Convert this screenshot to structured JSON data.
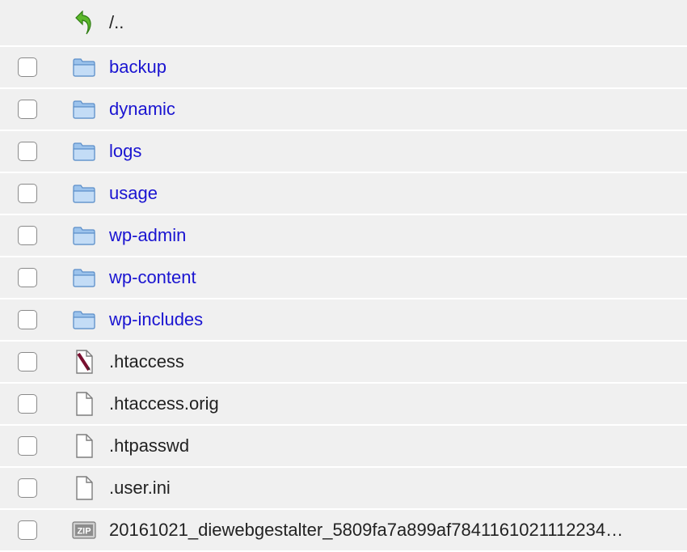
{
  "parent": {
    "label": "/..",
    "icon": "up-arrow-icon"
  },
  "entries": [
    {
      "name": "backup",
      "type": "folder",
      "icon": "folder-icon"
    },
    {
      "name": "dynamic",
      "type": "folder",
      "icon": "folder-icon"
    },
    {
      "name": "logs",
      "type": "folder",
      "icon": "folder-icon"
    },
    {
      "name": "usage",
      "type": "folder",
      "icon": "folder-icon"
    },
    {
      "name": "wp-admin",
      "type": "folder",
      "icon": "folder-icon"
    },
    {
      "name": "wp-content",
      "type": "folder",
      "icon": "folder-icon"
    },
    {
      "name": "wp-includes",
      "type": "folder",
      "icon": "folder-icon"
    },
    {
      "name": ".htaccess",
      "type": "file",
      "icon": "htaccess-file-icon"
    },
    {
      "name": ".htaccess.orig",
      "type": "file",
      "icon": "file-icon"
    },
    {
      "name": ".htpasswd",
      "type": "file",
      "icon": "file-icon"
    },
    {
      "name": ".user.ini",
      "type": "file",
      "icon": "file-icon"
    },
    {
      "name": "20161021_diewebgestalter_5809fa7a899af7841161021112234…",
      "type": "file",
      "icon": "zip-file-icon"
    }
  ],
  "colors": {
    "row_bg": "#f0f0f0",
    "folder_link": "#1a14d1",
    "file_text": "#222222",
    "separator": "#ffffff"
  }
}
